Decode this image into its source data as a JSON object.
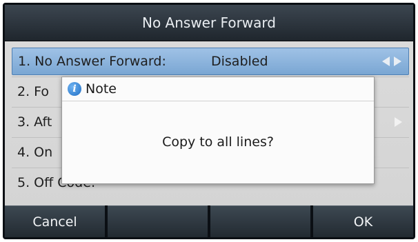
{
  "screen": {
    "title": "No Answer Forward"
  },
  "list": {
    "items": [
      {
        "label": "1. No Answer Forward:",
        "value": "Disabled",
        "selected": true
      },
      {
        "label": "2. Fo",
        "value": "",
        "selected": false
      },
      {
        "label": "3. Aft",
        "value": "",
        "selected": false
      },
      {
        "label": "4. On",
        "value": "",
        "selected": false
      },
      {
        "label": "5. Off Code:",
        "value": "",
        "selected": false
      }
    ]
  },
  "dialog": {
    "title": "Note",
    "icon": "info-icon",
    "message": "Copy to all lines?"
  },
  "softkeys": {
    "items": [
      {
        "label": "Cancel"
      },
      {
        "label": ""
      },
      {
        "label": ""
      },
      {
        "label": "OK"
      }
    ]
  },
  "colors": {
    "title_bar": "#2a323a",
    "selected_row": "#8db4de",
    "softkey_bg": "#2c353d",
    "dialog_bg": "#fbfbfb",
    "info_icon": "#1f6ec4"
  }
}
